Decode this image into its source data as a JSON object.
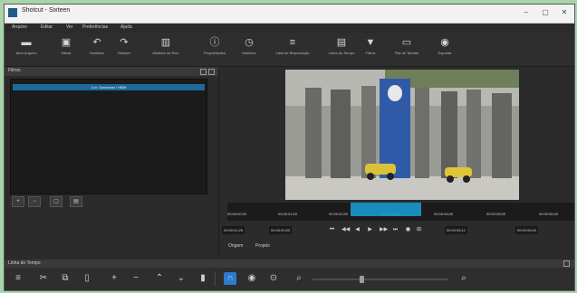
{
  "window": {
    "title": "Shotcut - Sixteen",
    "controls": {
      "minimize": "–",
      "maximize": "▢",
      "close": "✕"
    }
  },
  "menu": [
    "Arquivo",
    "Editar",
    "Ver",
    "Preferências",
    "Ajuda"
  ],
  "toolbar": [
    {
      "icon": "open-icon",
      "glyph": "▬",
      "label": "Abrir Arquivo"
    },
    {
      "icon": "save-icon",
      "glyph": "▣",
      "label": "Salvar"
    },
    {
      "icon": "undo-icon",
      "glyph": "↶",
      "label": "Desfazer"
    },
    {
      "icon": "redo-icon",
      "glyph": "↷",
      "label": "Refazer"
    },
    {
      "icon": "peak-meter-icon",
      "glyph": "▥",
      "label": "Medidor de Pico"
    },
    {
      "icon": "properties-icon",
      "glyph": "ⓘ",
      "label": "Propriedades"
    },
    {
      "icon": "history-icon",
      "glyph": "◷",
      "label": "Histórico"
    },
    {
      "icon": "playlist-icon",
      "glyph": "≡",
      "label": "Lista de Reprodução"
    },
    {
      "icon": "timeline-icon",
      "glyph": "▤",
      "label": "Linha do Tempo"
    },
    {
      "icon": "filters-icon",
      "glyph": "▼",
      "label": "Filtros"
    },
    {
      "icon": "jobs-icon",
      "glyph": "▭",
      "label": "Fila de Tarefas"
    },
    {
      "icon": "export-icon",
      "glyph": "◉",
      "label": "Exportar"
    }
  ],
  "filters_panel": {
    "title": "Filtros",
    "selected_filter": "Cor: Sombrear / HBW"
  },
  "filter_buttons": [
    {
      "icon": "add-filter-icon",
      "glyph": "+"
    },
    {
      "icon": "remove-filter-icon",
      "glyph": "−"
    },
    {
      "icon": "copy-filter-icon",
      "glyph": "▢"
    },
    {
      "icon": "deselect-filter-icon",
      "glyph": "▤"
    }
  ],
  "ruler": {
    "ticks": [
      "00:00:00;00",
      "00:00:01;00",
      "00:00:02;00",
      "00:00:03;00",
      "00:00:04;00",
      "00:00:05;00",
      "00:00:06;00"
    ]
  },
  "player": {
    "position": "00:00:01;26",
    "in_point": "00:00:00;00",
    "out_point": "00:00:05;11",
    "duration": "00:00:06;00",
    "controls": [
      "⏮",
      "◀◀",
      "◀",
      "▶",
      "▶▶",
      "⏭",
      "◼",
      "⊞"
    ]
  },
  "tabs": {
    "source": "Origem",
    "project": "Projeto"
  },
  "timeline": {
    "title": "Linha do Tempo",
    "tools": [
      {
        "icon": "menu-icon",
        "glyph": "≡"
      },
      {
        "icon": "cut-icon",
        "glyph": "✂"
      },
      {
        "icon": "copy-icon",
        "glyph": "⧉"
      },
      {
        "icon": "paste-icon",
        "glyph": "▯"
      },
      {
        "icon": "append-icon",
        "glyph": "+"
      },
      {
        "icon": "remove-icon",
        "glyph": "−"
      },
      {
        "icon": "lift-icon",
        "glyph": "⌃"
      },
      {
        "icon": "overwrite-icon",
        "glyph": "⌄"
      },
      {
        "icon": "split-icon",
        "glyph": "▮"
      },
      {
        "icon": "snap-icon",
        "glyph": "∩"
      },
      {
        "icon": "scrub-icon",
        "glyph": "◉"
      },
      {
        "icon": "ripple-icon",
        "glyph": "⊙"
      },
      {
        "icon": "zoom-out-icon",
        "glyph": "⌕"
      },
      {
        "icon": "zoom-in-icon",
        "glyph": "⌕"
      }
    ]
  },
  "colors": {
    "accent": "#1aa0d8",
    "snap_active": "#2d7bd0"
  }
}
